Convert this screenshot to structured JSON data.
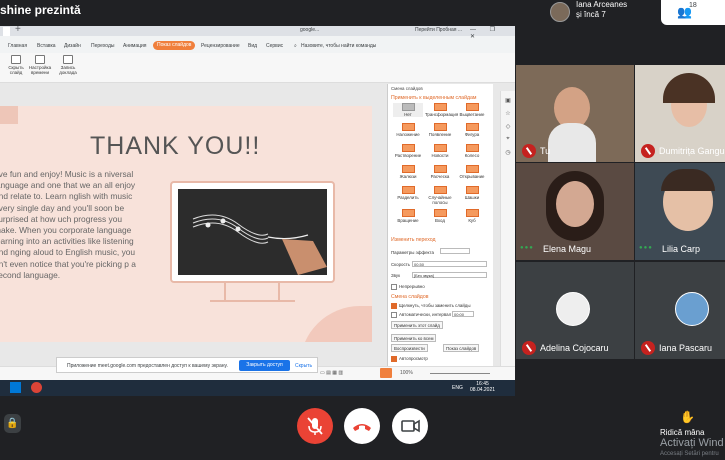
{
  "meeting": {
    "title": "shine prezintă"
  },
  "host": {
    "name_line1": "Iana Arceanes",
    "name_line2": "și încă 7"
  },
  "people": {
    "count": "18"
  },
  "browser": {
    "tab_doc": "google...",
    "tab_trial": "Перейти Пробная ...",
    "window_controls": "— ❐ ✕"
  },
  "menu": {
    "items": [
      "Главная",
      "Вставка",
      "Дизайн",
      "Переходы",
      "Анимация"
    ],
    "active": "Показ слайдов",
    "items2": [
      "Рецензирование",
      "Вид",
      "Сервис"
    ],
    "search": "Назовите, чтобы найти команды"
  },
  "ribbon": {
    "btn1": "Скрыть слайд",
    "btn2": "Настройка времени",
    "btn3": "Запись доклада"
  },
  "slide": {
    "title": "THANK YOU!!",
    "body": "ave fun and enjoy! Music is a niversal language and one that we an all enjoy and relate to. Learn nglish with music every single day and you'll soon be surprised at how uch progress you make. When you corporate language learning into an activities like listening and nging aloud to English music, you on't even notice that you're picking p a second language."
  },
  "panel": {
    "title": "Смена слайдов",
    "apply_heading": "Применить к выделенным слайдам",
    "tiles": [
      "Нет",
      "Трансформация",
      "Выцветание",
      "Наложение",
      "Появление",
      "Фигура",
      "Растворение",
      "Новости",
      "Колесо",
      "Жалюзи",
      "Расческа",
      "Открывание",
      "Разделить",
      "Случайные полосы",
      "Шашки",
      "Вращение",
      "Вход",
      "Куб"
    ],
    "change_heading": "Изменить переход",
    "effect_label": "Параметры эффекта",
    "speed_label": "Скорость",
    "speed_value": "00.50",
    "sound_label": "Звук",
    "sound_value": "[Без звука]",
    "loop_label": "Непрерывно",
    "advance_heading": "Смена слайдов",
    "on_click": "Щелкнуть, чтобы заменить слайды",
    "auto": "Автоматически, интервал",
    "auto_value": "00:00",
    "apply_this": "Применить этот слайд",
    "apply_all": "Применить ко всем",
    "play": "Воспроизвести",
    "slideshow": "Показ слайдов",
    "autopreview": "Автопросмотр"
  },
  "notification": {
    "text": "Приложение meet.google.com предоставлен доступ к вашему экрану.",
    "share_label": "Закрыть доступ",
    "hide_label": "Скрыть"
  },
  "statusbar": {
    "zoom": "100%"
  },
  "taskbar": {
    "lang": "ENG",
    "time": "16:45",
    "date": "08.04.2021"
  },
  "participants": [
    {
      "name": "Tu"
    },
    {
      "name": "Dumitrița Gangur"
    },
    {
      "name": "Elena Magu"
    },
    {
      "name": "Lilia Carp"
    },
    {
      "name": "Adelina Cojocaru"
    },
    {
      "name": "Iana Pascaru"
    }
  ],
  "controls": {
    "raise_hand": "Ridică mâna",
    "watermark": "Activați Wind",
    "watermark2": "Accesați Setări pentru"
  },
  "colors": {
    "background": "#202124",
    "mic_off": "#c5221f",
    "end_call": "#ea4335",
    "slide_bg": "#f8e2da",
    "accent_orange": "#f07f3c",
    "share_blue": "#1a73e8"
  }
}
